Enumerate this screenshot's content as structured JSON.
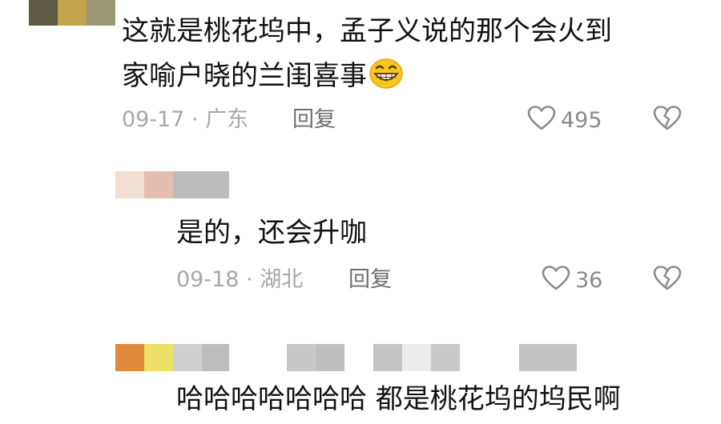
{
  "comments": [
    {
      "text_line1": "这就是桃花坞中，孟子义说的那个会火到",
      "text_line2": "家喻户晓的兰闺喜事",
      "emoji": "grinning-face-emoji",
      "date": "09-17",
      "location": "广东",
      "reply_label": "回复",
      "likes": "495"
    },
    {
      "text": "是的，还会升咖",
      "date": "09-18",
      "location": "湖北",
      "reply_label": "回复",
      "likes": "36"
    },
    {
      "text": "哈哈哈哈哈哈哈 都是桃花坞的坞民啊"
    }
  ],
  "separator": " · ",
  "icons": {
    "like": "heart-outline-icon",
    "dislike": "broken-heart-icon"
  },
  "colors": {
    "text": "#111111",
    "meta": "#a7a7a7",
    "reply": "#6f6f6f",
    "icon": "#8a8a8a"
  }
}
